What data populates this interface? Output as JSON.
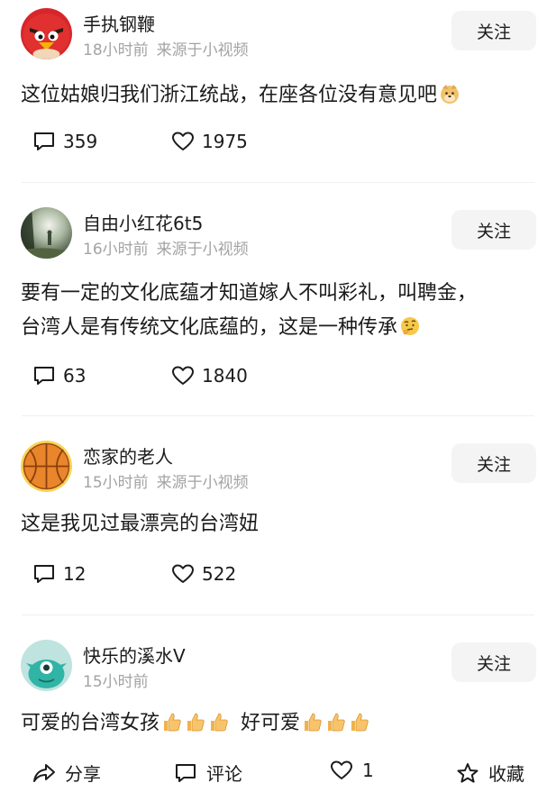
{
  "comments": [
    {
      "username": "手执钢鞭",
      "time": "18小时前",
      "source": "来源于小视频",
      "follow_label": "关注",
      "lines": [
        "这位姑娘归我们浙江统战，在座各位没有意见吧"
      ],
      "emoji": "doge-emoji",
      "reply_count": "359",
      "like_count": "1975"
    },
    {
      "username": "自由小红花6t5",
      "time": "16小时前",
      "source": "来源于小视频",
      "follow_label": "关注",
      "lines": [
        "要有一定的文化底蕴才知道嫁人不叫彩礼，叫聘金，",
        "台湾人是有传统文化底蕴的，这是一种传承"
      ],
      "emoji": "thinking-emoji",
      "reply_count": "63",
      "like_count": "1840"
    },
    {
      "username": "恋家的老人",
      "time": "15小时前",
      "source": "来源于小视频",
      "follow_label": "关注",
      "lines": [
        "这是我见过最漂亮的台湾妞"
      ],
      "reply_count": "12",
      "like_count": "522"
    },
    {
      "username": "快乐的溪水V",
      "time": "15小时前",
      "follow_label": "关注",
      "text_a": "可爱的台湾女孩",
      "text_b": "好可爱"
    }
  ],
  "bottom_bar": {
    "share_label": "分享",
    "comment_label": "评论",
    "like_count": "1",
    "favorite_label": "收藏"
  }
}
